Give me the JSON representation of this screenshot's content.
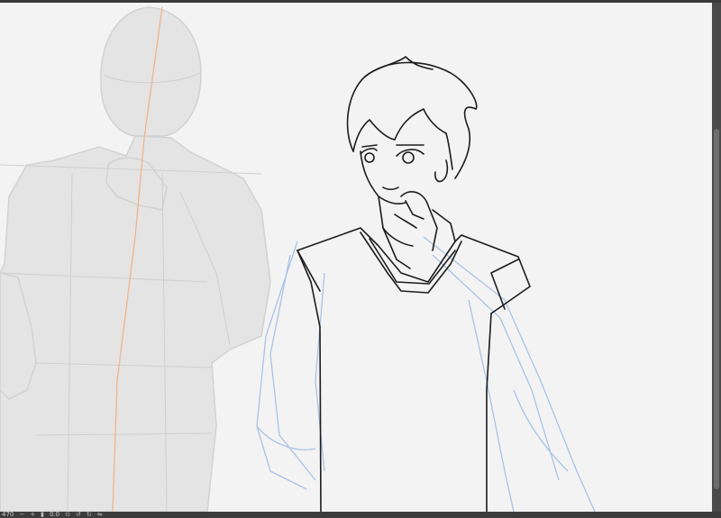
{
  "statusbar": {
    "zoom": "470",
    "angle": "0.0",
    "zoom_out_icon": "minus-icon",
    "zoom_in_icon": "plus-icon",
    "icons": [
      "zoom-fit-icon",
      "rotate-left-icon",
      "rotate-right-icon",
      "flip-icon"
    ]
  },
  "colors": {
    "canvas": "#f3f3f3",
    "mannequin": "#e2e2e2",
    "guide": "#f0b48c",
    "lineart": "#1c1c1c",
    "sketch": "#a9c3e6"
  }
}
